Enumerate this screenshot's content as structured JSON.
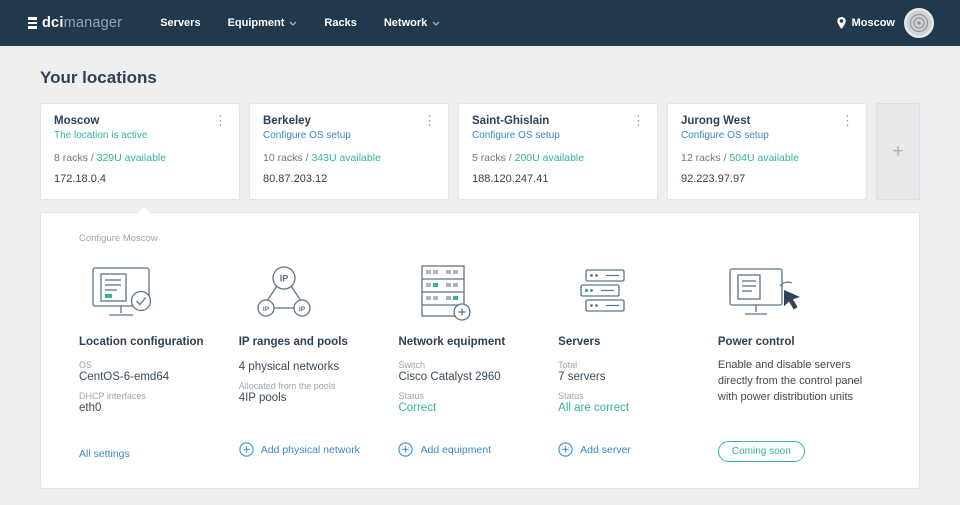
{
  "colors": {
    "navbar": "#20394c",
    "accent_green": "#35b39b",
    "link_blue": "#3c87c8"
  },
  "icons": {
    "kebab": "⋮",
    "add_plus": "+"
  },
  "navbar": {
    "logo_bold": "dci",
    "logo_light": "manager",
    "items": [
      {
        "label": "Servers"
      },
      {
        "label": "Equipment"
      },
      {
        "label": "Racks"
      },
      {
        "label": "Network"
      }
    ],
    "location": "Moscow"
  },
  "page": {
    "title": "Your locations"
  },
  "locations": [
    {
      "name": "Moscow",
      "status": "The location is active",
      "racks": "8 racks / ",
      "available": "329U available",
      "ip": "172.18.0.4"
    },
    {
      "name": "Berkeley",
      "status": "Configure OS setup",
      "racks": "10 racks / ",
      "available": "343U available",
      "ip": "80.87.203.12"
    },
    {
      "name": "Saint-Ghislain",
      "status": "Configure OS setup",
      "racks": "5 racks / ",
      "available": "200U available",
      "ip": "188.120.247.41"
    },
    {
      "name": "Jurong West",
      "status": "Configure OS setup",
      "racks": "12 racks / ",
      "available": "504U available",
      "ip": "92.223.97.97"
    }
  ],
  "panel": {
    "caption": "Configure Moscow",
    "columns": [
      {
        "title": "Location configuration",
        "fields": [
          {
            "label": "OS",
            "value": "CentOS-6-emd64"
          },
          {
            "label": "DHCP interfaces",
            "value": "eth0"
          }
        ],
        "action": "All settings"
      },
      {
        "title": "IP ranges and pools",
        "fields": [
          {
            "label": "",
            "value": "4 physical networks"
          },
          {
            "label": "Allocated from the pools",
            "value": "4IP pools"
          }
        ],
        "action": "Add physical network"
      },
      {
        "title": "Network equipment",
        "fields": [
          {
            "label": "Switch",
            "value": "Cisco Catalyst 2960"
          },
          {
            "label": "Status",
            "value": "Correct"
          }
        ],
        "action": "Add equipment"
      },
      {
        "title": "Servers",
        "fields": [
          {
            "label": "Total",
            "value": "7 servers"
          },
          {
            "label": "Status",
            "value": "All are correct"
          }
        ],
        "action": "Add server"
      },
      {
        "title": "Power control",
        "description": "Enable and disable servers directly from the control panel with power distribution units",
        "action": "Coming soon"
      }
    ]
  }
}
